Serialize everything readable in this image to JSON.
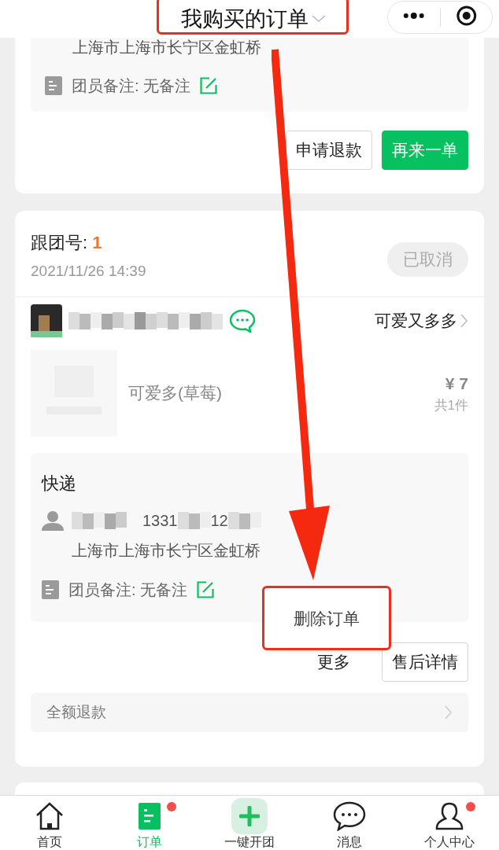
{
  "header": {
    "title": "我购买的订单"
  },
  "previous_order": {
    "address": "上海市上海市长宁区金虹桥",
    "remark": "团员备注: 无备注",
    "buttons": [
      {
        "label": "申请退款",
        "kind": "outline"
      },
      {
        "label": "再来一单",
        "kind": "primary"
      }
    ]
  },
  "order": {
    "group_label": "跟团号: ",
    "group_number": "1",
    "time": "2021/11/26 14:39",
    "status": "已取消",
    "seller": "可爱又多多",
    "item": {
      "name": "可爱多(草莓)",
      "price": "¥ 7",
      "count": "共1件"
    },
    "delivery": {
      "method": "快递",
      "phone_parts": [
        "1331",
        "12"
      ],
      "address": "上海市上海市长宁区金虹桥",
      "remark": "团员备注: 无备注"
    },
    "more": "更多",
    "buttons": [
      {
        "label": "售后详情",
        "kind": "outline"
      }
    ],
    "popover": {
      "items": [
        "删除订单"
      ]
    },
    "refund": "全额退款"
  },
  "tabs": [
    {
      "label": "首页",
      "kind": "home",
      "selected": false,
      "badge": false
    },
    {
      "label": "订单",
      "kind": "orders",
      "selected": true,
      "badge": true
    },
    {
      "label": "一键开团",
      "kind": "plus",
      "selected": false,
      "badge": false
    },
    {
      "label": "消息",
      "kind": "chat",
      "selected": false,
      "badge": false
    },
    {
      "label": "个人中心",
      "kind": "person",
      "selected": false,
      "badge": true
    }
  ]
}
